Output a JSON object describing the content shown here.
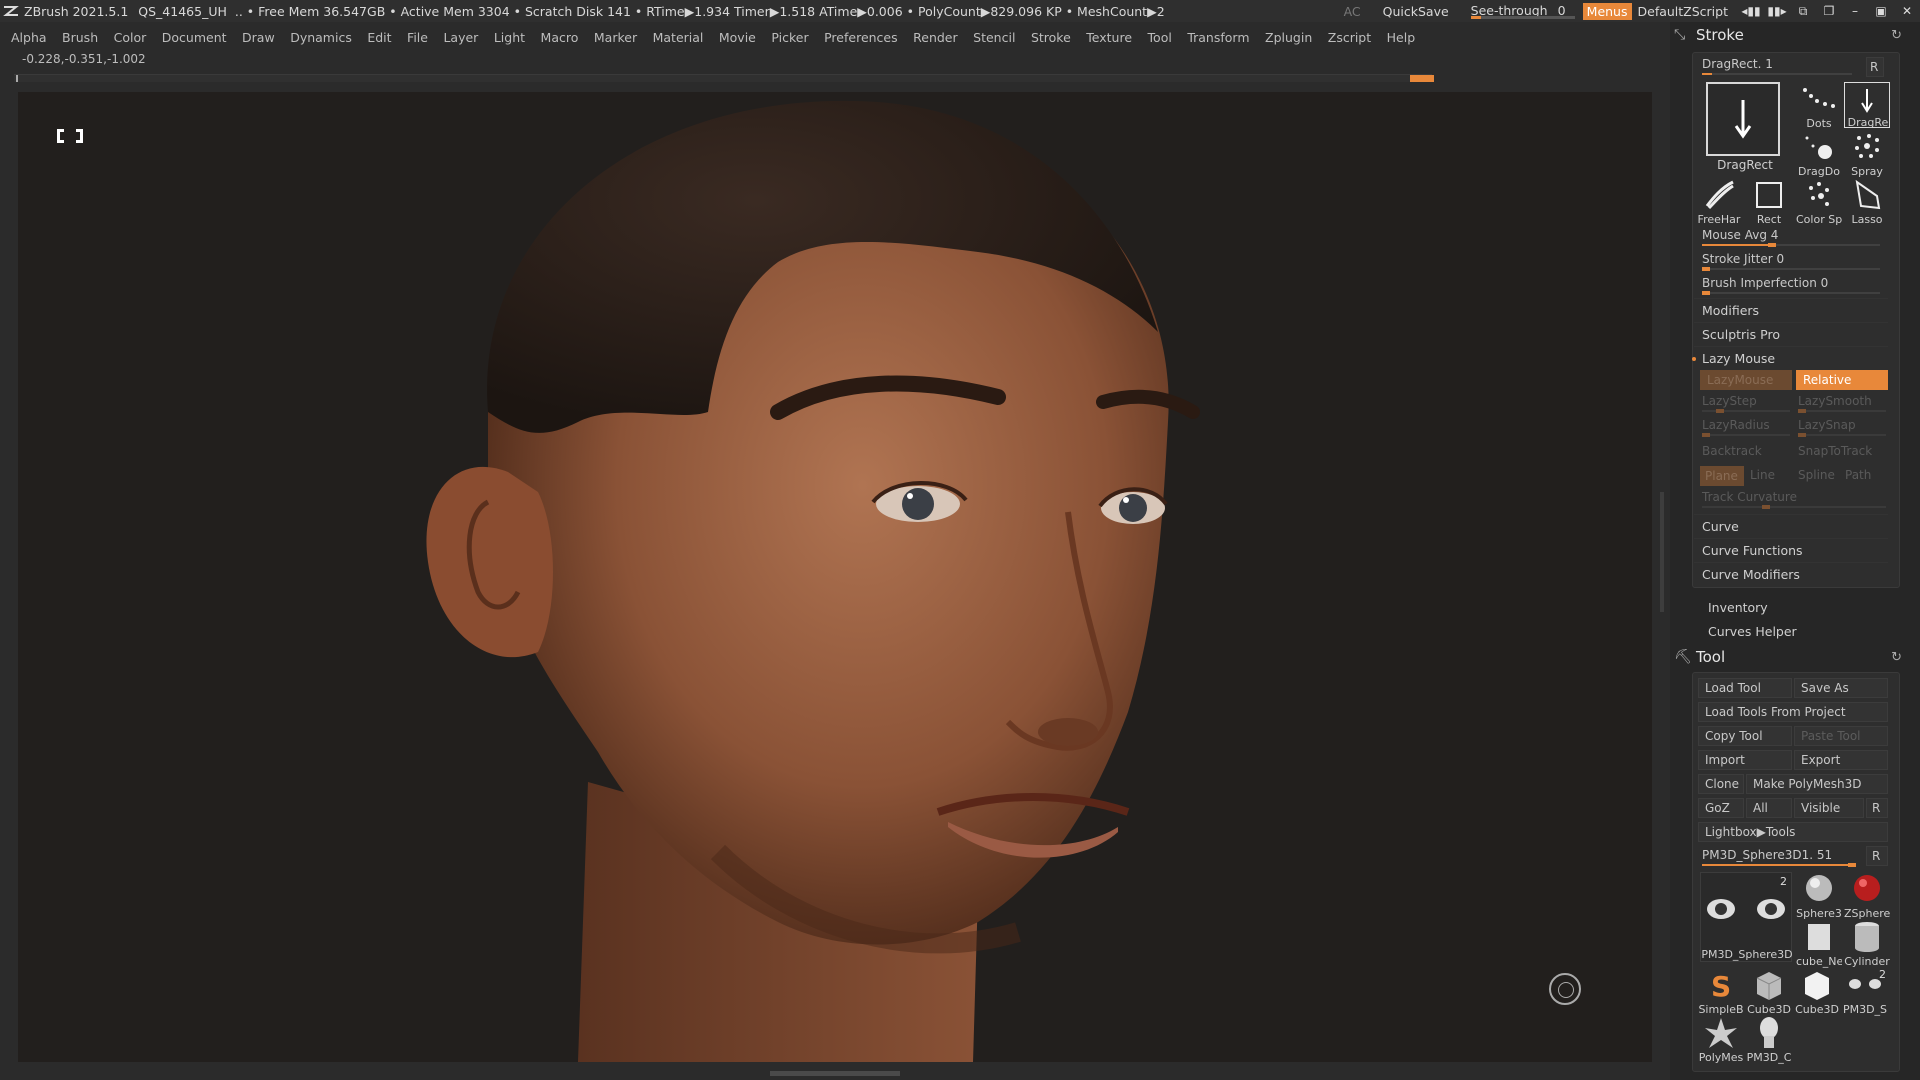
{
  "title_bar": {
    "app": "ZBrush 2021.5.1",
    "project": "QS_41465_UH",
    "stats": ".. • Free Mem 36.547GB • Active Mem 3304 • Scratch Disk 141 •  RTime▶1.934 Timer▶1.518 ATime▶0.006 • PolyCount▶829.096 KP  • MeshCount▶2",
    "ac": "AC",
    "quicksave": "QuickSave",
    "see_through_label": "See-through",
    "see_through_value": "0",
    "see_through_level": 0,
    "menus": "Menus",
    "default_zscript": "DefaultZScript"
  },
  "menu": [
    "Alpha",
    "Brush",
    "Color",
    "Document",
    "Draw",
    "Dynamics",
    "Edit",
    "File",
    "Layer",
    "Light",
    "Macro",
    "Marker",
    "Material",
    "Movie",
    "Picker",
    "Preferences",
    "Render",
    "Stencil",
    "Stroke",
    "Texture",
    "Tool",
    "Transform",
    "Zplugin",
    "Zscript",
    "Help"
  ],
  "coords": "-0.228,-0.351,-1.002",
  "stroke_panel": {
    "title": "Stroke",
    "dragrect_label": "DragRect. 1",
    "r": "R",
    "strokes": {
      "main": "DragRect",
      "dots": "Dots",
      "dragre": "DragRe",
      "dragdo": "DragDo",
      "spray": "Spray",
      "freehand": "FreeHar",
      "rect": "Rect",
      "colorsp": "Color Sp",
      "lasso": "Lasso"
    },
    "sliders": {
      "mouse_avg": "Mouse Avg 4",
      "mouse_avg_level": 0.4,
      "stroke_jitter": "Stroke Jitter 0",
      "stroke_jitter_level": 0,
      "brush_imperfection": "Brush Imperfection 0",
      "brush_imperfection_level": 0
    },
    "modifiers": "Modifiers",
    "sculptris_pro": "Sculptris Pro",
    "lazy_mouse": "Lazy Mouse",
    "lazy": {
      "lazymouse": "LazyMouse",
      "relative": "Relative",
      "lazystep": "LazyStep",
      "lazysmooth": "LazySmooth",
      "lazyradius": "LazyRadius",
      "lazysnap": "LazySnap",
      "backtrack": "Backtrack",
      "snaptotrack": "SnapToTrack",
      "plane": "Plane",
      "line": "Line",
      "spline": "Spline",
      "path": "Path",
      "track_curvature": "Track Curvature"
    },
    "curve": "Curve",
    "curve_functions": "Curve Functions",
    "curve_modifiers": "Curve Modifiers",
    "inventory": "Inventory",
    "curves_helper": "Curves Helper"
  },
  "tool_panel": {
    "title": "Tool",
    "load_tool": "Load Tool",
    "save_as": "Save As",
    "load_from_project": "Load Tools From Project",
    "copy_tool": "Copy Tool",
    "paste_tool": "Paste Tool",
    "import": "Import",
    "export": "Export",
    "clone": "Clone",
    "make_polymesh": "Make PolyMesh3D",
    "goz": "GoZ",
    "all": "All",
    "visible": "Visible",
    "r": "R",
    "lightbox_tools": "Lightbox▶Tools",
    "current_tool": "PM3D_Sphere3D1. 51",
    "current_tool_level": 0.85,
    "thumb_count": "2",
    "thumbs": {
      "main": "PM3D_Sphere3D",
      "sphere": "Sphere3",
      "zsphere": "ZSphere",
      "cube_ne": "cube_Ne",
      "cylinder": "Cylinder",
      "simpleb": "SimpleB",
      "cube3d": "Cube3D",
      "cube3d2": "Cube3D",
      "pm3d_s": "PM3D_S",
      "pm3d_s_count": "2",
      "polymes": "PolyMes",
      "pm3d_c": "PM3D_C"
    }
  }
}
